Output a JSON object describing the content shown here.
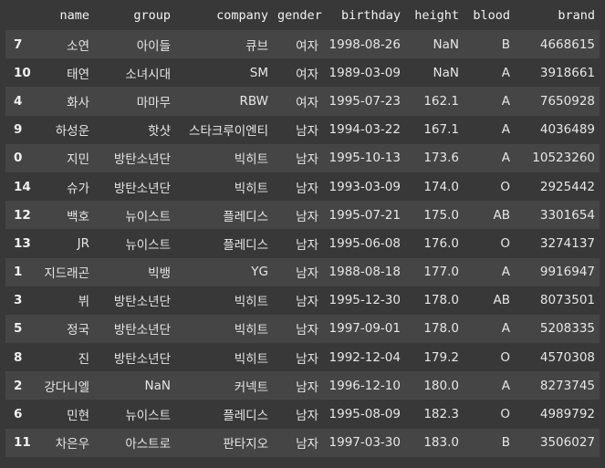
{
  "table": {
    "columns": [
      "",
      "name",
      "group",
      "company",
      "gender",
      "birthday",
      "height",
      "blood",
      "brand"
    ],
    "rows": [
      [
        "7",
        "소연",
        "아이들",
        "큐브",
        "여자",
        "1998-08-26",
        "NaN",
        "B",
        "4668615"
      ],
      [
        "10",
        "태연",
        "소녀시대",
        "SM",
        "여자",
        "1989-03-09",
        "NaN",
        "A",
        "3918661"
      ],
      [
        "4",
        "화사",
        "마마무",
        "RBW",
        "여자",
        "1995-07-23",
        "162.1",
        "A",
        "7650928"
      ],
      [
        "9",
        "하성운",
        "핫샷",
        "스타크루이엔티",
        "남자",
        "1994-03-22",
        "167.1",
        "A",
        "4036489"
      ],
      [
        "0",
        "지민",
        "방탄소년단",
        "빅히트",
        "남자",
        "1995-10-13",
        "173.6",
        "A",
        "10523260"
      ],
      [
        "14",
        "슈가",
        "방탄소년단",
        "빅히트",
        "남자",
        "1993-03-09",
        "174.0",
        "O",
        "2925442"
      ],
      [
        "12",
        "백호",
        "뉴이스트",
        "플레디스",
        "남자",
        "1995-07-21",
        "175.0",
        "AB",
        "3301654"
      ],
      [
        "13",
        "JR",
        "뉴이스트",
        "플레디스",
        "남자",
        "1995-06-08",
        "176.0",
        "O",
        "3274137"
      ],
      [
        "1",
        "지드래곤",
        "빅뱅",
        "YG",
        "남자",
        "1988-08-18",
        "177.0",
        "A",
        "9916947"
      ],
      [
        "3",
        "뷔",
        "방탄소년단",
        "빅히트",
        "남자",
        "1995-12-30",
        "178.0",
        "AB",
        "8073501"
      ],
      [
        "5",
        "정국",
        "방탄소년단",
        "빅히트",
        "남자",
        "1997-09-01",
        "178.0",
        "A",
        "5208335"
      ],
      [
        "8",
        "진",
        "방탄소년단",
        "빅히트",
        "남자",
        "1992-12-04",
        "179.2",
        "O",
        "4570308"
      ],
      [
        "2",
        "강다니엘",
        "NaN",
        "커넥트",
        "남자",
        "1996-12-10",
        "180.0",
        "A",
        "8273745"
      ],
      [
        "6",
        "민현",
        "뉴이스트",
        "플레디스",
        "남자",
        "1995-08-09",
        "182.3",
        "O",
        "4989792"
      ],
      [
        "11",
        "차은우",
        "아스트로",
        "판타지오",
        "남자",
        "1997-03-30",
        "183.0",
        "B",
        "3506027"
      ]
    ]
  },
  "colors": {
    "background": "#383838",
    "row_stripe": "#454545",
    "text": "#e6e6e6"
  }
}
